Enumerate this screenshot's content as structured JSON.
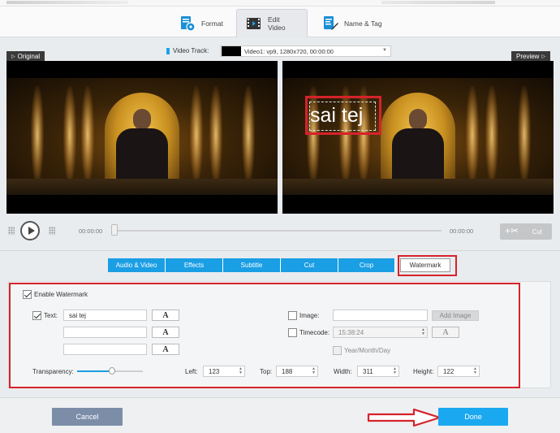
{
  "window": {
    "close_icon": "close-icon"
  },
  "tabs": [
    {
      "label": "Format",
      "icon": "format-settings-icon",
      "active": false
    },
    {
      "label": "Edit Video",
      "icon": "film-edit-icon",
      "active": true
    },
    {
      "label": "Name & Tag",
      "icon": "name-tag-edit-icon",
      "active": false
    }
  ],
  "video_track": {
    "label": "Video Track:",
    "value": "Video1: vp9, 1280x720, 00:00:00"
  },
  "panes": {
    "original_label": "Original",
    "preview_label": "Preview"
  },
  "watermark_overlay_text": "sai tej",
  "player": {
    "time_start": "00:00:00",
    "time_end": "00:00:00",
    "cut_label": "Cut",
    "progress": 0
  },
  "edit_tabs": [
    "Audio & Video",
    "Effects",
    "Subtitle",
    "Cut",
    "Crop",
    "Watermark"
  ],
  "watermark": {
    "enable_label": "Enable Watermark",
    "enabled": true,
    "text_label": "Text:",
    "text_enabled": true,
    "text_values": [
      "sai tej",
      "",
      ""
    ],
    "font_button": "A",
    "image_label": "Image:",
    "image_enabled": false,
    "image_value": "",
    "add_image_label": "Add Image",
    "timecode_label": "Timecode:",
    "timecode_enabled": false,
    "timecode_value": "15:38:24",
    "ymd_label": "Year/Month/Day",
    "transparency_label": "Transparency:",
    "transparency": 0.53,
    "left_label": "Left:",
    "left_value": "123",
    "top_label": "Top:",
    "top_value": "188",
    "width_label": "Width:",
    "width_value": "311",
    "height_label": "Height:",
    "height_value": "122"
  },
  "footer": {
    "cancel_label": "Cancel",
    "done_label": "Done"
  },
  "colors": {
    "accent": "#1aa8f0",
    "tab_blue": "#1a9ee4",
    "cancel": "#7c8da8",
    "annotation_red": "#d6232a"
  }
}
